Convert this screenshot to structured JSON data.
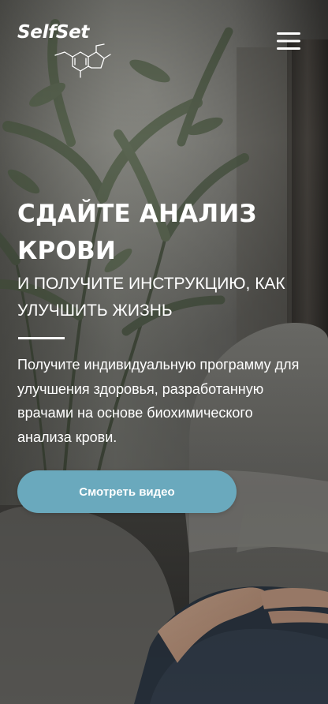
{
  "brand": {
    "name": "SelfSet"
  },
  "header": {
    "menu_icon": "hamburger-icon"
  },
  "hero": {
    "title": "СДАЙТЕ АНАЛИЗ КРОВИ",
    "subtitle": "И ПОЛУЧИТЕ ИНСТРУКЦИЮ, КАК УЛУЧШИТЬ ЖИЗНЬ",
    "description": "Получите индивидуальную программу для улучшения здоровья, разработанную врачами на основе биохимического анализа крови.",
    "cta_label": "Смотреть видео"
  },
  "colors": {
    "accent": "#6aa9bd",
    "text": "#ffffff"
  }
}
